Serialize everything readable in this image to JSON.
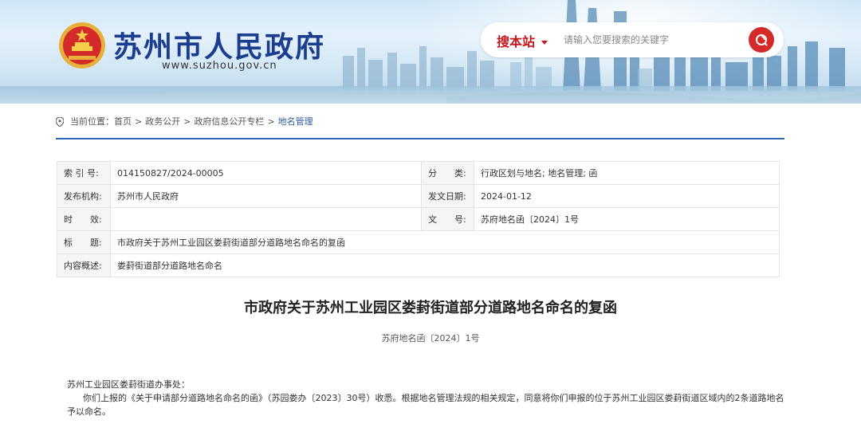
{
  "header": {
    "site_title": "苏州市人民政府",
    "site_url": "www.suzhou.gov.cn",
    "search": {
      "scope": "搜本站",
      "placeholder": "请输入您要搜索的关键字"
    }
  },
  "breadcrumb": {
    "label": "当前位置：",
    "items": [
      "首页",
      "政务公开",
      "政府信息公开专栏",
      "地名管理"
    ],
    "separator": ">"
  },
  "info": {
    "index_label": "索 引 号:",
    "index_value": "014150827/2024-00005",
    "category_label": "分　　类:",
    "category_value": "行政区划与地名;  地名管理;  函",
    "publisher_label": "发布机构:",
    "publisher_value": "苏州市人民政府",
    "date_label": "发文日期:",
    "date_value": "2024-01-12",
    "validity_label": "时　　效:",
    "validity_value": "",
    "docno_label": "文　　号:",
    "docno_value": "苏府地名函〔2024〕1号",
    "title_label": "标　　题:",
    "title_value": "市政府关于苏州工业园区娄葑街道部分道路地名命名的复函",
    "summary_label": "内容概述:",
    "summary_value": "娄葑街道部分道路地名命名"
  },
  "article": {
    "title": "市政府关于苏州工业园区娄葑街道部分道路地名命名的复函",
    "doc_number": "苏府地名函〔2024〕1号",
    "salutation": "苏州工业园区娄葑街道办事处：",
    "paragraph1": "你们上报的《关于申请部分道路地名命名的函》（苏园娄办〔2023〕30号）收悉。根据地名管理法规的相关规定，同意将你们申报的位于苏州工业园区娄葑街道区域内的2条道路地名予以命名。"
  },
  "colors": {
    "title_blue": "#1b3d8f",
    "accent_red": "#c4161c",
    "rule_blue": "#2c6ab8"
  }
}
